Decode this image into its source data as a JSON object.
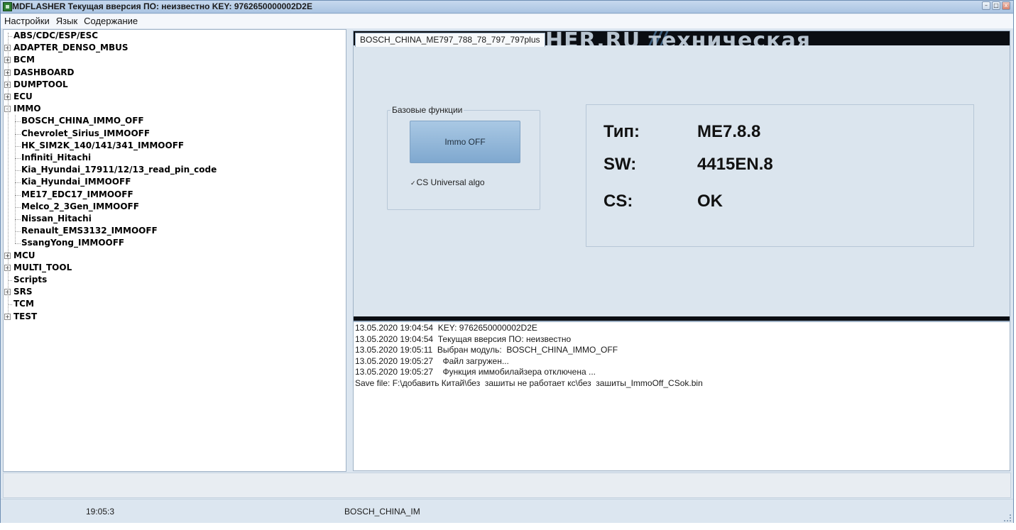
{
  "window": {
    "title": "MDFLASHER  Текущая вверсия ПО: неизвестно  KEY: 9762650000002D2E",
    "minimize": "–",
    "maximize": "□",
    "close": "x"
  },
  "menu": [
    "Настройки",
    "Язык",
    "Содержание"
  ],
  "tree": {
    "items": [
      {
        "label": "ABS/CDC/ESP/ESC",
        "expander": ""
      },
      {
        "label": "ADAPTER_DENSO_MBUS",
        "expander": "+"
      },
      {
        "label": "BCM",
        "expander": "+"
      },
      {
        "label": "DASHBOARD",
        "expander": "+"
      },
      {
        "label": "DUMPTOOL",
        "expander": "+"
      },
      {
        "label": "ECU",
        "expander": "+"
      },
      {
        "label": "IMMO",
        "expander": "–"
      },
      {
        "label": "BOSCH_CHINA_IMMO_OFF",
        "expander": ""
      },
      {
        "label": "Chevrolet_Sirius_IMMOOFF",
        "expander": ""
      },
      {
        "label": "HK_SIM2K_140/141/341_IMMOOFF",
        "expander": ""
      },
      {
        "label": "Infiniti_Hitachi",
        "expander": ""
      },
      {
        "label": "Kia_Hyundai_17911/12/13_read_pin_code",
        "expander": ""
      },
      {
        "label": "Kia_Hyundai_IMMOOFF",
        "expander": ""
      },
      {
        "label": "ME17_EDC17_IMMOOFF",
        "expander": ""
      },
      {
        "label": "Melco_2_3Gen_IMMOOFF",
        "expander": ""
      },
      {
        "label": "Nissan_Hitachi",
        "expander": ""
      },
      {
        "label": "Renault_EMS3132_IMMOOFF",
        "expander": ""
      },
      {
        "label": "SsangYong_IMMOOFF",
        "expander": ""
      },
      {
        "label": "MCU",
        "expander": "+"
      },
      {
        "label": "MULTI_TOOL",
        "expander": "+"
      },
      {
        "label": "Scripts",
        "expander": ""
      },
      {
        "label": "SRS",
        "expander": "+"
      },
      {
        "label": "TCM",
        "expander": ""
      },
      {
        "label": "TEST",
        "expander": "+"
      }
    ]
  },
  "panel": {
    "tab_label": "BOSCH_CHINA_ME797_788_78_797_797plus",
    "banner_text": "HER.RU техническая",
    "group_title": "Базовые функции",
    "immo_button": "Immo OFF",
    "checkbox_mark": "✓",
    "checkbox_label": "CS Universal algo",
    "info": {
      "type_label": "Тип:",
      "type_value": "ME7.8.8",
      "sw_label": "SW:",
      "sw_value": "4415EN.8",
      "cs_label": "CS:",
      "cs_value": "OK"
    }
  },
  "log": [
    "13.05.2020 19:04:54  KEY: 9762650000002D2E",
    "13.05.2020 19:04:54  Текущая вверсия ПО: неизвестно",
    "13.05.2020 19:05:11  Выбран модуль:  BOSCH_CHINA_IMMO_OFF",
    "13.05.2020 19:05:27    Файл загружен...",
    "13.05.2020 19:05:27    Функция иммобилайзера отключена ...",
    "Save file: F:\\добавить Китай\\без  зашиты не работает кс\\без  зашиты_ImmoOff_CSok.bin"
  ],
  "status": {
    "time": "19:05:3",
    "module": "BOSCH_CHINA_IM"
  }
}
